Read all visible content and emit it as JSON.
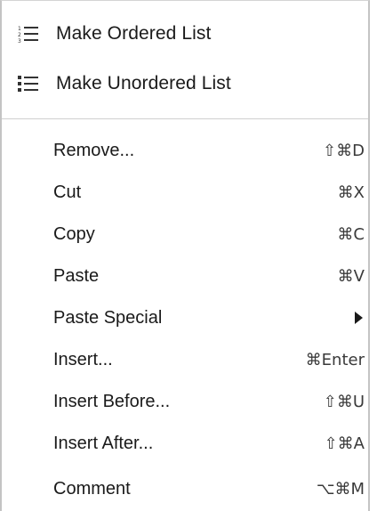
{
  "list_actions": [
    {
      "label": "Make Ordered List",
      "icon": "ordered-list-icon"
    },
    {
      "label": "Make Unordered List",
      "icon": "unordered-list-icon"
    }
  ],
  "items": [
    {
      "label": "Remove...",
      "shortcut": "⇧⌘D"
    },
    {
      "label": "Cut",
      "shortcut": "⌘X"
    },
    {
      "label": "Copy",
      "shortcut": "⌘C"
    },
    {
      "label": "Paste",
      "shortcut": "⌘V"
    },
    {
      "label": "Paste Special",
      "submenu_icon": "triangle-right-icon"
    },
    {
      "label": "Insert...",
      "shortcut": "⌘Enter"
    },
    {
      "label": "Insert Before...",
      "shortcut": "⇧⌘U"
    },
    {
      "label": "Insert After...",
      "shortcut": "⇧⌘A"
    },
    {
      "label": "Comment",
      "shortcut": "⌥⌘M"
    }
  ]
}
